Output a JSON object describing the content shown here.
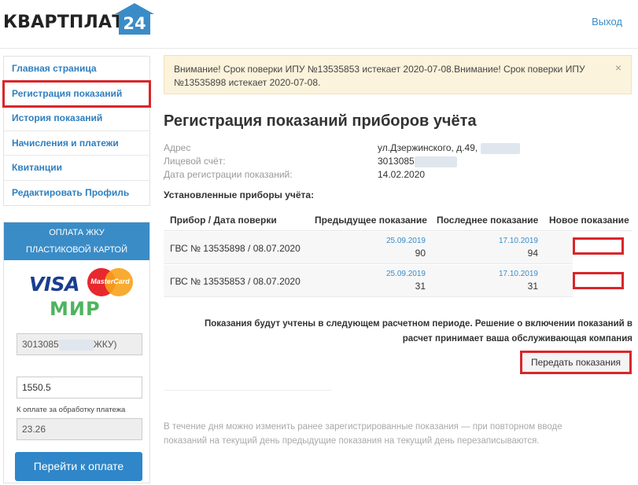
{
  "header": {
    "logo_text": "КВАРТПЛАТА",
    "logo_number": "24",
    "logout": "Выход"
  },
  "nav": {
    "items": [
      {
        "label": "Главная страница"
      },
      {
        "label": "Регистрация показаний"
      },
      {
        "label": "История показаний"
      },
      {
        "label": "Начисления и платежи"
      },
      {
        "label": "Квитанции"
      },
      {
        "label": "Редактировать Профиль"
      }
    ]
  },
  "payment": {
    "header_line1": "Оплата ЖКУ",
    "header_line2": "пластиковой картой",
    "card_brands": [
      "VISA",
      "MasterCard",
      "МИР"
    ],
    "account_prefix": "3013085",
    "account_suffix": "ЖКУ)",
    "amount": "1550.5",
    "fee_label": "К оплате за обработку платежа",
    "fee_value": "23.26",
    "pay_button": "Перейти к оплате"
  },
  "alert": {
    "text": "Внимание! Срок поверки ИПУ №13535853 истекает 2020-07-08.Внимание! Срок поверки ИПУ №13535898 истекает 2020-07-08.",
    "close": "×"
  },
  "main": {
    "title": "Регистрация показаний приборов учёта",
    "info": [
      {
        "label": "Адрес",
        "value": "ул.Дзержинского, д.49, "
      },
      {
        "label": "Лицевой счёт:",
        "value": "3013085"
      },
      {
        "label": "Дата регистрации показаний:",
        "value": "14.02.2020"
      }
    ],
    "devices_label": "Установленные приборы учёта:",
    "table": {
      "headers": [
        "Прибор / Дата поверки",
        "Предыдущее показание",
        "Последнее показание",
        "Новое показание"
      ],
      "rows": [
        {
          "device": "ГВС № 13535898 / 08.07.2020",
          "prev_date": "25.09.2019",
          "prev_value": "90",
          "last_date": "17.10.2019",
          "last_value": "94"
        },
        {
          "device": "ГВС № 13535853 / 08.07.2020",
          "prev_date": "25.09.2019",
          "prev_value": "31",
          "last_date": "17.10.2019",
          "last_value": "31"
        }
      ]
    },
    "note_line1": "Показания будут учтены в следующем расчетном периоде. Решение о включении показаний в",
    "note_line2": "расчет принимает ваша обслуживающая компания",
    "submit_button": "Передать показания",
    "footnote_line1": "В течение дня можно изменить ранее зарегистрированные показания — при повторном вводе",
    "footnote_line2": "показаний на текущий день предыдущие показания на текущий день перезаписываются."
  },
  "colors": {
    "accent": "#3a8cc7",
    "highlight": "#d9262a",
    "alert_bg": "#fcf3dc"
  }
}
